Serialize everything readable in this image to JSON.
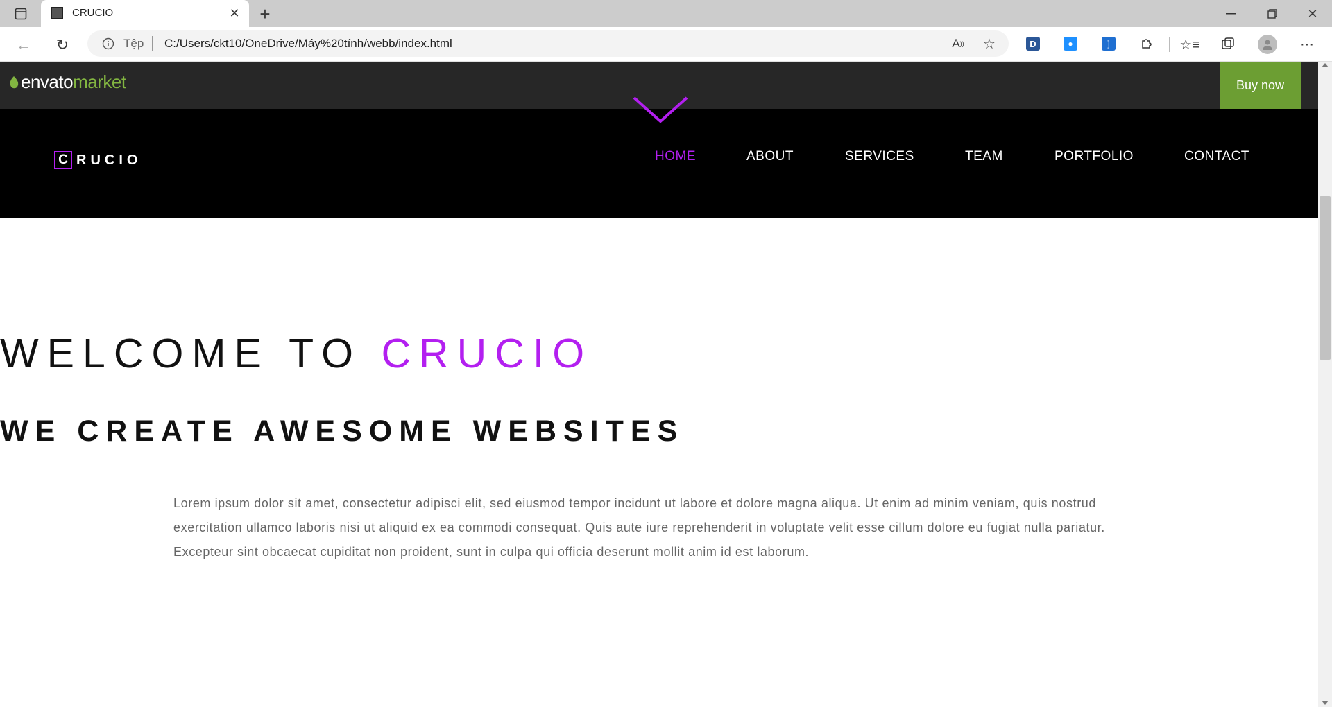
{
  "browser": {
    "tab_title": "CRUCIO",
    "new_tab_icon": "plus-icon",
    "close_tab_icon": "close-icon",
    "site_info_label": "Tệp",
    "url": "C:/Users/ckt10/OneDrive/Máy%20tính/webb/index.html",
    "window_controls": [
      "minimize-icon",
      "restore-icon",
      "close-icon"
    ],
    "extension_icons": [
      "d-extension-icon",
      "drop-extension-icon",
      "bracket-extension-icon",
      "puzzle-icon",
      "favorites-icon",
      "collections-icon",
      "profile-icon",
      "more-icon"
    ]
  },
  "envato": {
    "logo_envato": "envato",
    "logo_market": "market",
    "buy_now": "Buy now",
    "accent": "#6c9e33"
  },
  "nav": {
    "logo_letter": "C",
    "logo_rest": "RUCIO",
    "items": [
      "HOME",
      "ABOUT",
      "SERVICES",
      "TEAM",
      "PORTFOLIO",
      "CONTACT"
    ],
    "active_index": 0,
    "accent": "#b31ff0"
  },
  "hero": {
    "title_prefix": "WELCOME TO",
    "title_accent": "CRUCIO",
    "subtitle": "WE CREATE AWESOME WEBSITES",
    "body": "Lorem ipsum dolor sit amet, consectetur adipisci elit, sed eiusmod tempor incidunt ut labore et dolore magna aliqua. Ut enim ad minim veniam, quis nostrud exercitation ullamco laboris nisi ut aliquid ex ea commodi consequat. Quis aute iure reprehenderit in voluptate velit esse cillum dolore eu fugiat nulla pariatur. Excepteur sint obcaecat cupiditat non proident, sunt in culpa qui officia deserunt mollit anim id est laborum."
  }
}
